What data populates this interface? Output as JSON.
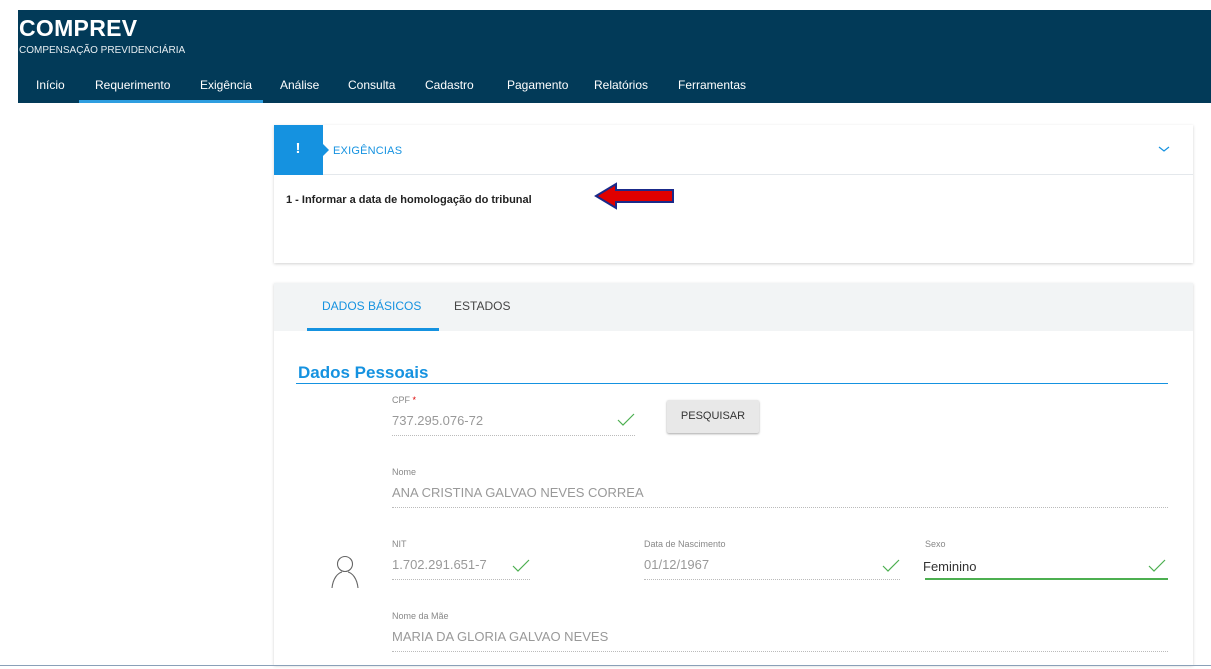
{
  "header": {
    "title": "COMPREV",
    "subtitle": "COMPENSAÇÃO PREVIDENCIÁRIA",
    "nav": [
      "Início",
      "Requerimento",
      "Exigência",
      "Análise",
      "Consulta",
      "Cadastro",
      "Pagamento",
      "Relatórios",
      "Ferramentas"
    ],
    "active_nav": "Requerimento"
  },
  "exigencias": {
    "title": "EXIGÊNCIAS",
    "badge_glyph": "!",
    "items": [
      "1 - Informar a data de homologação do tribunal"
    ]
  },
  "tabs": [
    "DADOS BÁSICOS",
    "ESTADOS"
  ],
  "active_tab": "DADOS BÁSICOS",
  "dados_pessoais": {
    "title": "Dados Pessoais",
    "cpf": {
      "label": "CPF",
      "required_mark": "*",
      "value": "737.295.076-72"
    },
    "pesquisar_label": "PESQUISAR",
    "nome": {
      "label": "Nome",
      "value": "ANA CRISTINA GALVAO NEVES CORREA"
    },
    "nit": {
      "label": "NIT",
      "value": "1.702.291.651-7"
    },
    "data_nascimento": {
      "label": "Data de Nascimento",
      "value": "01/12/1967"
    },
    "sexo": {
      "label": "Sexo",
      "value": "Feminino"
    },
    "nome_mae": {
      "label": "Nome da Mãe",
      "value": "MARIA DA GLORIA GALVAO NEVES"
    }
  },
  "colors": {
    "header_bg": "#023a58",
    "accent": "#1592e0",
    "valid": "#4caf50",
    "annotation_arrow": "#e00000"
  }
}
